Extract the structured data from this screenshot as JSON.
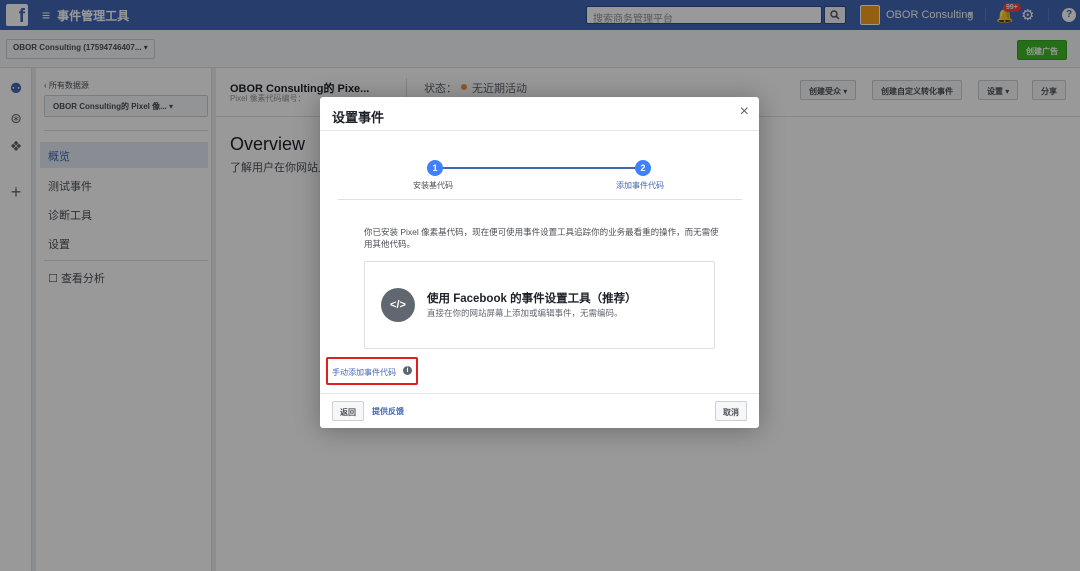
{
  "topbar": {
    "logo_letter": "f",
    "menu_glyph": "≡",
    "app_title": "事件管理工具",
    "search_placeholder": "搜索商务管理平台",
    "account_name": "OBOR Consulting",
    "notification_badge": "99+",
    "help_glyph": "?"
  },
  "subbar": {
    "business_select": "OBOR Consulting (17594746407...  ▾",
    "create_ad": "创建广告"
  },
  "leftnav": {
    "back": "‹ 所有数据源",
    "pixel_select": "OBOR Consulting的 Pixel 像...   ▾",
    "items": [
      "概览",
      "测试事件",
      "诊断工具",
      "设置"
    ],
    "analytics": "查看分析"
  },
  "main": {
    "title": "OBOR Consulting的 Pixe...",
    "subtitle": "Pixel 像素代码编号：",
    "status_label": "状态：",
    "status_value": "无近期活动",
    "buttons": [
      "创建受众 ▾",
      "创建自定义转化事件",
      "设置 ▾",
      "分享"
    ],
    "overview": "Overview",
    "overview_sub": "了解用户在你网站上"
  },
  "modal": {
    "title": "设置事件",
    "close": "×",
    "steps": [
      {
        "num": "1",
        "label": "安装基代码"
      },
      {
        "num": "2",
        "label": "添加事件代码"
      }
    ],
    "description": "你已安装 Pixel 像素基代码，现在便可使用事件设置工具追踪你的业务最看重的操作，而无需使用其他代码。",
    "tool_icon": "</>",
    "tool_title": "使用 Facebook 的事件设置工具（推荐）",
    "tool_subtitle": "直接在你的网站屏幕上添加或编辑事件，无需编码。",
    "manual_link": "手动添加事件代码",
    "footer": {
      "back": "返回",
      "feedback": "提供反馈",
      "cancel": "取消"
    }
  },
  "colors": {
    "brand": "#4267b2",
    "step_blue": "#4080ff",
    "green": "#42b72a",
    "highlight_red": "#e02020"
  }
}
